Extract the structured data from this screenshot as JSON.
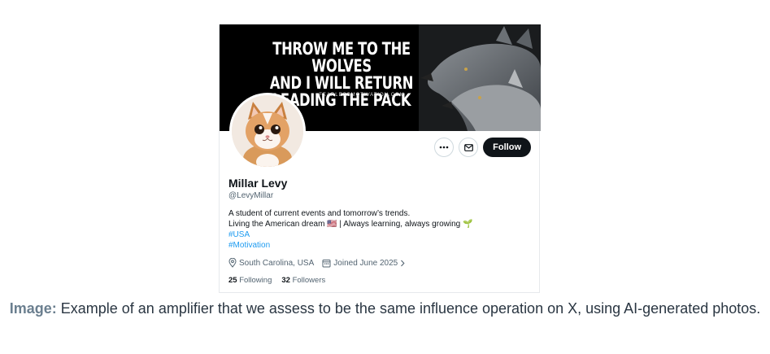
{
  "banner": {
    "lines": [
      "THROW ME TO THE WOLVES",
      "AND I WILL RETURN",
      "LEADING THE PACK"
    ],
    "website": "FEARLESSMOTIVATION.COM"
  },
  "actions": {
    "more_icon": "more-icon",
    "message_icon": "mail-icon",
    "follow_label": "Follow"
  },
  "profile": {
    "name": "Millar Levy",
    "handle": "@LevyMillar",
    "bio_line1": "A student of current events and tomorrow’s trends.",
    "bio_line2_a": "Living the American dream",
    "bio_flag": "🇺🇸",
    "bio_line2_b": " | Always learning, always growing ",
    "bio_sprout": "🌱",
    "hashtags": [
      "#USA",
      "#Motivation"
    ],
    "location": "South Carolina, USA",
    "joined": "Joined June 2025",
    "following_count": "25",
    "following_label": "Following",
    "followers_count": "32",
    "followers_label": "Followers"
  },
  "caption": {
    "label": "Image:",
    "text": " Example of an amplifier that we assess to be the same influence operation on X, using AI-generated photos."
  },
  "colors": {
    "link": "#1d9bf0",
    "follow_bg": "#0f1419",
    "muted": "#536471"
  }
}
